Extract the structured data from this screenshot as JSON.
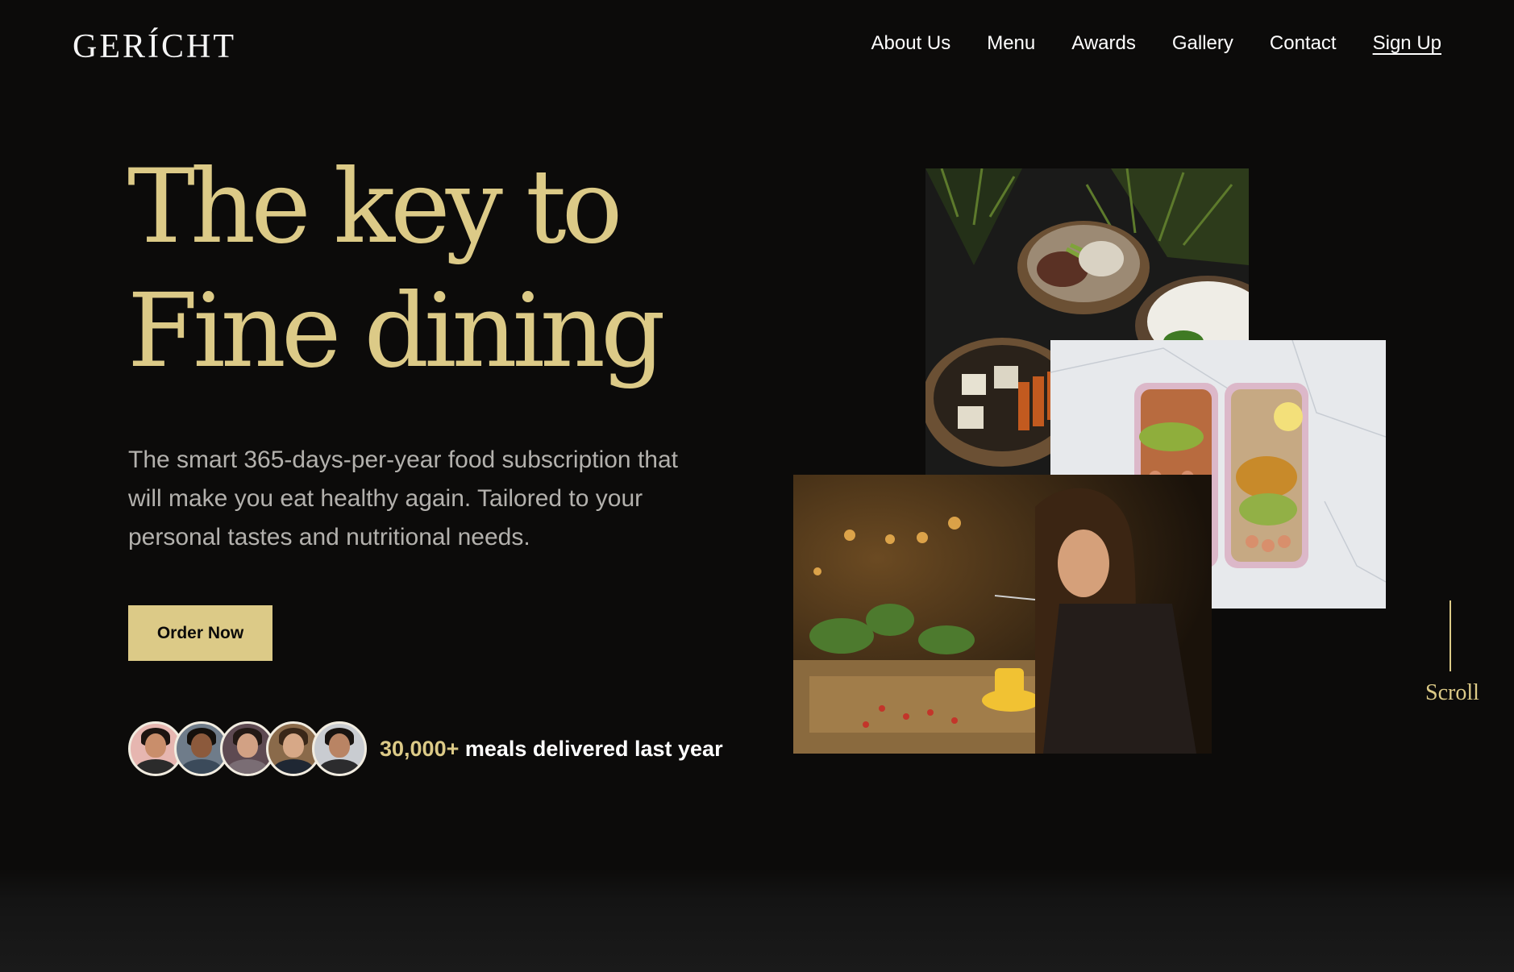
{
  "brand": {
    "logo": "GERÍCHT"
  },
  "nav": {
    "items": [
      "About Us",
      "Menu",
      "Awards",
      "Gallery",
      "Contact"
    ],
    "signup": "Sign Up"
  },
  "hero": {
    "headline_line1": "The key to",
    "headline_line2": "Fine dining",
    "subtitle": "The smart 365-days-per-year food subscription that will make you eat healthy again. Tailored to your personal tastes and nutritional needs.",
    "cta": "Order Now",
    "proof_number": "30,000+",
    "proof_text": "meals delivered last year"
  },
  "scroll": {
    "label": "Scroll"
  },
  "colors": {
    "accent": "#dcca87",
    "background": "#0c0b0a",
    "muted_text": "#b3b1ad"
  },
  "images": [
    {
      "name": "bowls-photo",
      "alt": "bowls of food"
    },
    {
      "name": "mealprep-photo",
      "alt": "meal prep containers"
    },
    {
      "name": "dining-photo",
      "alt": "woman dining"
    }
  ]
}
